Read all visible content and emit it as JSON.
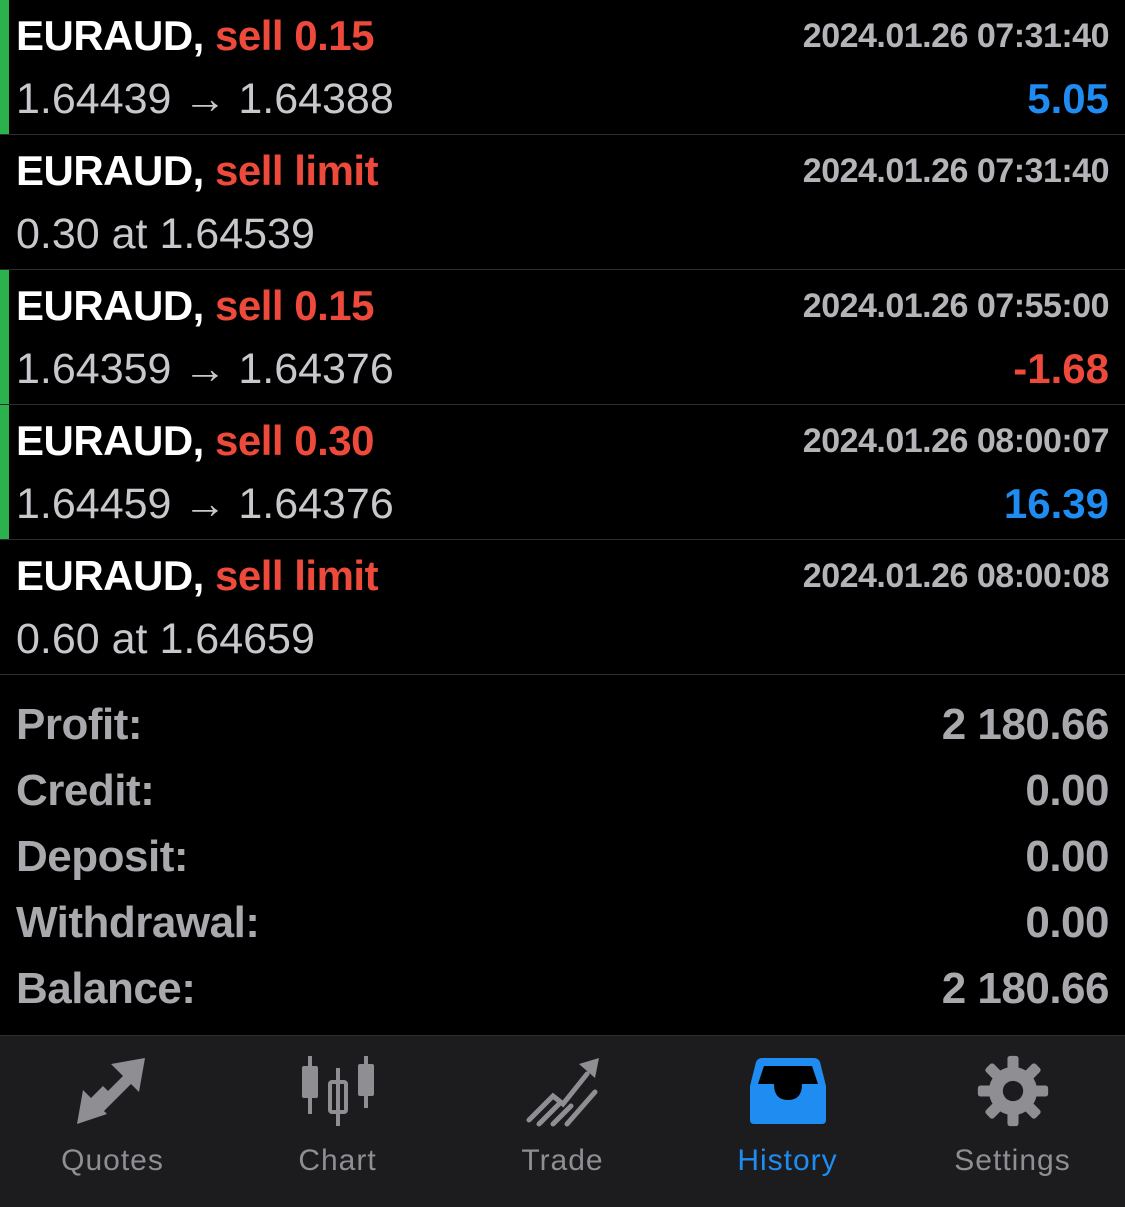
{
  "colors": {
    "sell": "#ee4a3b",
    "profit_positive": "#1e8cf0",
    "profit_negative": "#ee4a3b",
    "deal_bar": "#2bb24c",
    "tab_active": "#1e8cf0",
    "tab_inactive": "#8e8e93"
  },
  "history": [
    {
      "symbol": "EURAUD,",
      "side": "sell 0.15",
      "time": "2024.01.26 07:31:40",
      "detail": "1.64439 → 1.64388",
      "profit": "5.05",
      "profit_sign": "positive",
      "is_deal": true
    },
    {
      "symbol": "EURAUD,",
      "side": "sell limit",
      "time": "2024.01.26 07:31:40",
      "detail": "0.30 at 1.64539",
      "profit": "",
      "profit_sign": "none",
      "is_deal": false
    },
    {
      "symbol": "EURAUD,",
      "side": "sell 0.15",
      "time": "2024.01.26 07:55:00",
      "detail": "1.64359 → 1.64376",
      "profit": "-1.68",
      "profit_sign": "negative",
      "is_deal": true
    },
    {
      "symbol": "EURAUD,",
      "side": "sell 0.30",
      "time": "2024.01.26 08:00:07",
      "detail": "1.64459 → 1.64376",
      "profit": "16.39",
      "profit_sign": "positive",
      "is_deal": true
    },
    {
      "symbol": "EURAUD,",
      "side": "sell limit",
      "time": "2024.01.26 08:00:08",
      "detail": "0.60 at 1.64659",
      "profit": "",
      "profit_sign": "none",
      "is_deal": false
    }
  ],
  "summary": [
    {
      "label": "Profit:",
      "value": "2 180.66"
    },
    {
      "label": "Credit:",
      "value": "0.00"
    },
    {
      "label": "Deposit:",
      "value": "0.00"
    },
    {
      "label": "Withdrawal:",
      "value": "0.00"
    },
    {
      "label": "Balance:",
      "value": "2 180.66"
    }
  ],
  "tabs": [
    {
      "label": "Quotes",
      "icon": "quotes-arrows-icon",
      "active": false
    },
    {
      "label": "Chart",
      "icon": "candlestick-icon",
      "active": false
    },
    {
      "label": "Trade",
      "icon": "trade-trend-icon",
      "active": false
    },
    {
      "label": "History",
      "icon": "inbox-tray-icon",
      "active": true
    },
    {
      "label": "Settings",
      "icon": "gear-icon",
      "active": false
    }
  ]
}
